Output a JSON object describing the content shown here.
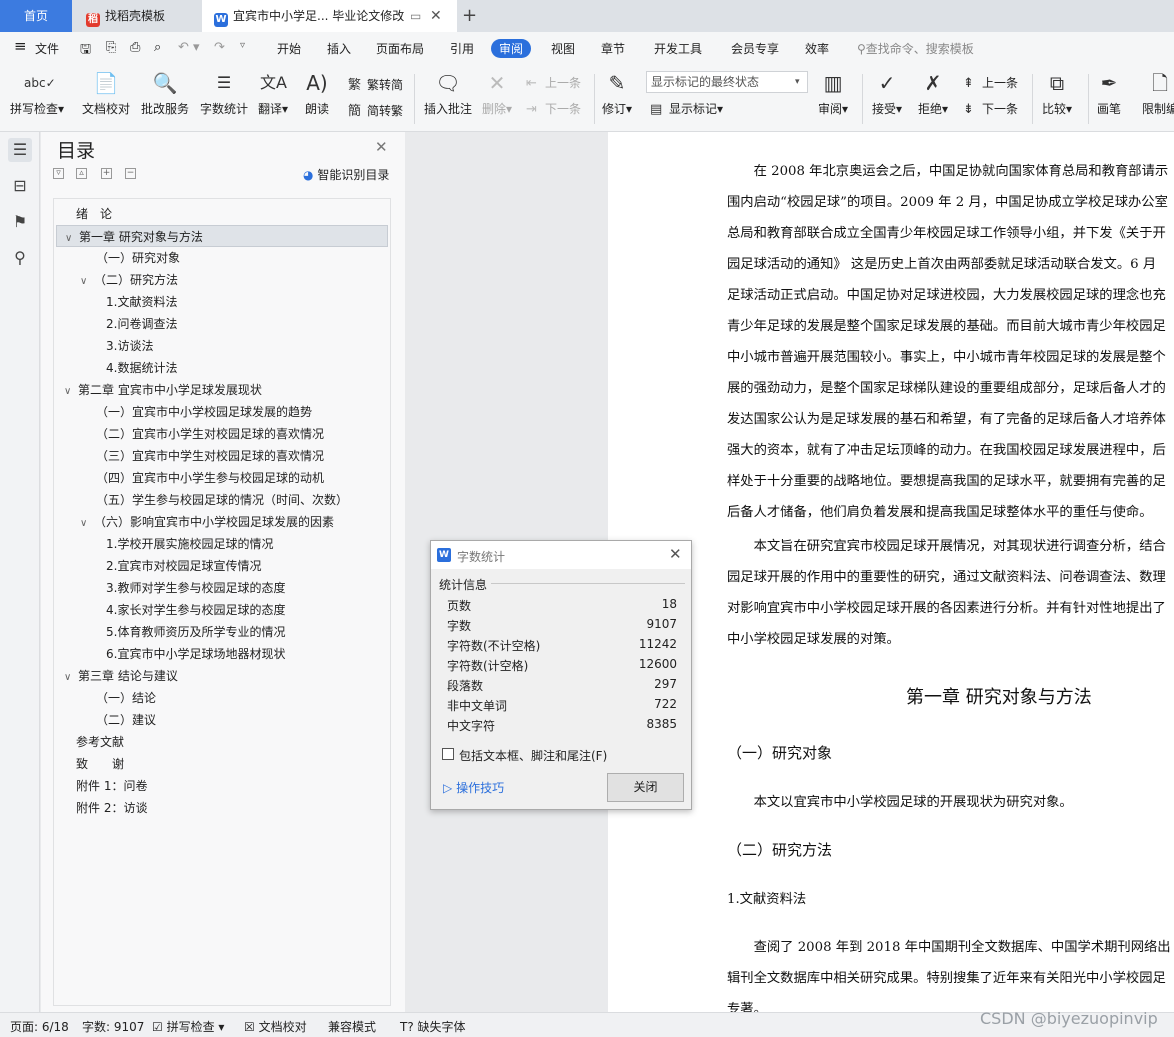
{
  "tabs": {
    "home": "首页",
    "template": "找稻壳模板",
    "document": "宜宾市中小学足... 毕业论文修改"
  },
  "menu": {
    "file": "文件",
    "items": [
      "开始",
      "插入",
      "页面布局",
      "引用",
      "审阅",
      "视图",
      "章节",
      "开发工具",
      "会员专享",
      "效率"
    ],
    "active": "审阅",
    "search": "查找命令、搜索模板"
  },
  "ribbon": {
    "spellcheck": "拼写检查",
    "doc_check": "文档校对",
    "annotate_service": "批改服务",
    "word_count": "字数统计",
    "translate": "翻译",
    "read_aloud": "朗读",
    "trad_to_simp": "繁转简",
    "simp_to_trad": "简转繁",
    "insert_comment": "插入批注",
    "delete": "删除",
    "prev_comment": "上一条",
    "next_comment": "下一条",
    "revise": "修订",
    "show_mode": "显示标记的最终状态",
    "show_markup": "显示标记",
    "review": "审阅",
    "accept": "接受",
    "reject": "拒绝",
    "prev_change": "上一条",
    "next_change": "下一条",
    "compare": "比较",
    "brush": "画笔",
    "restrict": "限制编"
  },
  "toc": {
    "title": "目录",
    "smart": "智能识别目录",
    "items": [
      "绪　论",
      "第一章  研究对象与方法",
      "（一）研究对象",
      "（二）研究方法",
      "1.文献资料法",
      "2.问卷调查法",
      "3.访谈法",
      "4.数据统计法",
      "第二章  宜宾市中小学足球发展现状",
      "（一）宜宾市中小学校园足球发展的趋势",
      "（二）宜宾市小学生对校园足球的喜欢情况",
      "（三）宜宾市中学生对校园足球的喜欢情况",
      "（四）宜宾市中小学生参与校园足球的动机",
      "（五）学生参与校园足球的情况（时间、次数）",
      "（六）影响宜宾市中小学校园足球发展的因素",
      "1.学校开展实施校园足球的情况",
      "2.宜宾市对校园足球宣传情况",
      "3.教师对学生参与校园足球的态度",
      "4.家长对学生参与校园足球的态度",
      "5.体育教师资历及所学专业的情况",
      "6.宜宾市中小学足球场地器材现状",
      "第三章  结论与建议",
      "（一）结论",
      "（二）建议",
      "参考文献",
      "致　　谢",
      "附件 1：问卷",
      "附件 2：访谈"
    ]
  },
  "document": {
    "para1": [
      "　　在 2008 年北京奥运会之后，中国足协就向国家体育总局和教育部请示",
      "围内启动“校园足球”的项目。2009 年 2 月，中国足协成立学校足球办公室",
      "总局和教育部联合成立全国青少年校园足球工作领导小组，并下发《关于开",
      "园足球活动的通知》 这是历史上首次由两部委就足球活动联合发文。6 月",
      "足球活动正式启动。中国足协对足球进校园，大力发展校园足球的理念也充",
      "青少年足球的发展是整个国家足球发展的基础。而目前大城市青少年校园足",
      "中小城市普遍开展范围较小。事实上，中小城市青年校园足球的发展是整个",
      "展的强劲动力，是整个国家足球梯队建设的重要组成部分，足球后备人才的",
      "发达国家公认为是足球发展的基石和希望，有了完备的足球后备人才培养体",
      "强大的资本，就有了冲击足坛顶峰的动力。在我国校园足球发展进程中，后",
      "样处于十分重要的战略地位。要想提高我国的足球水平，就要拥有完善的足",
      "后备人才储备，他们肩负着发展和提高我国足球整体水平的重任与使命。"
    ],
    "para2": [
      "　　本文旨在研究宜宾市校园足球开展情况，对其现状进行调查分析，结合",
      "园足球开展的作用中的重要性的研究，通过文献资料法、问卷调查法、数理",
      "对影响宜宾市中小学校园足球开展的各因素进行分析。并有针对性地提出了",
      "中小学校园足球发展的对策。"
    ],
    "chapter1": "第一章  研究对象与方法",
    "sec1": "（一）研究对象",
    "sec1_text": "　　本文以宜宾市中小学校园足球的开展现状为研究对象。",
    "sec2": "（二）研究方法",
    "sub1": "1.文献资料法",
    "para3": [
      "　　查阅了 2008 年到 2018 年中国期刊全文数据库、中国学术期刊网络出",
      "辑刊全文数据库中相关研究成果。特别搜集了近年来有关阳光中小学校园足",
      "专著。"
    ]
  },
  "dialog": {
    "title": "字数统计",
    "section": "统计信息",
    "rows": [
      {
        "label": "页数",
        "value": "18"
      },
      {
        "label": "字数",
        "value": "9107"
      },
      {
        "label": "字符数(不计空格)",
        "value": "11242"
      },
      {
        "label": "字符数(计空格)",
        "value": "12600"
      },
      {
        "label": "段落数",
        "value": "297"
      },
      {
        "label": "非中文单词",
        "value": "722"
      },
      {
        "label": "中文字符",
        "value": "8385"
      }
    ],
    "include_label": "包括文本框、脚注和尾注(F)",
    "tips": "操作技巧",
    "close": "关闭"
  },
  "status": {
    "page": "页面: 6/18",
    "words": "字数: 9107",
    "spell": "拼写检查",
    "doc_check": "文档校对",
    "compat": "兼容模式",
    "missing_font": "缺失字体"
  },
  "watermark": "CSDN @biyezuopinvip"
}
